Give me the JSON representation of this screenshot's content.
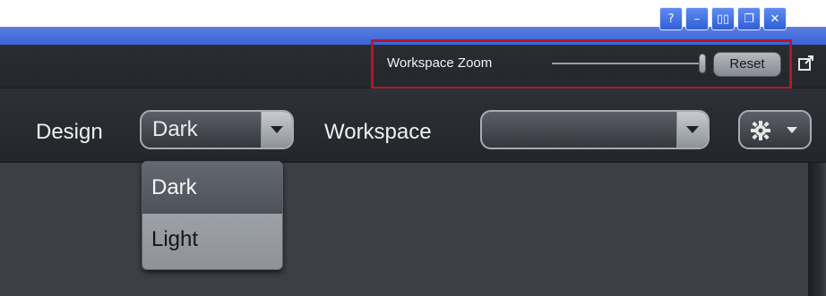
{
  "window_controls": [
    {
      "label": "?",
      "icon": "help-icon"
    },
    {
      "label": "–",
      "icon": "minimize-icon"
    },
    {
      "label": "▯▯",
      "icon": "tile-icon"
    },
    {
      "label": "❐",
      "icon": "restore-icon"
    },
    {
      "label": "✕",
      "icon": "close-icon"
    }
  ],
  "zoom": {
    "label": "Workspace Zoom",
    "reset_label": "Reset",
    "level": 1.0
  },
  "toolbar": {
    "design_label": "Design",
    "design_value": "Dark",
    "workspace_label": "Workspace",
    "workspace_value": ""
  },
  "design_dropdown": {
    "options": [
      "Dark",
      "Light"
    ],
    "selected": "Dark"
  },
  "colors": {
    "highlight": "#b0182a",
    "title_blue": "#3b63d8",
    "background": "#2b2d33"
  }
}
